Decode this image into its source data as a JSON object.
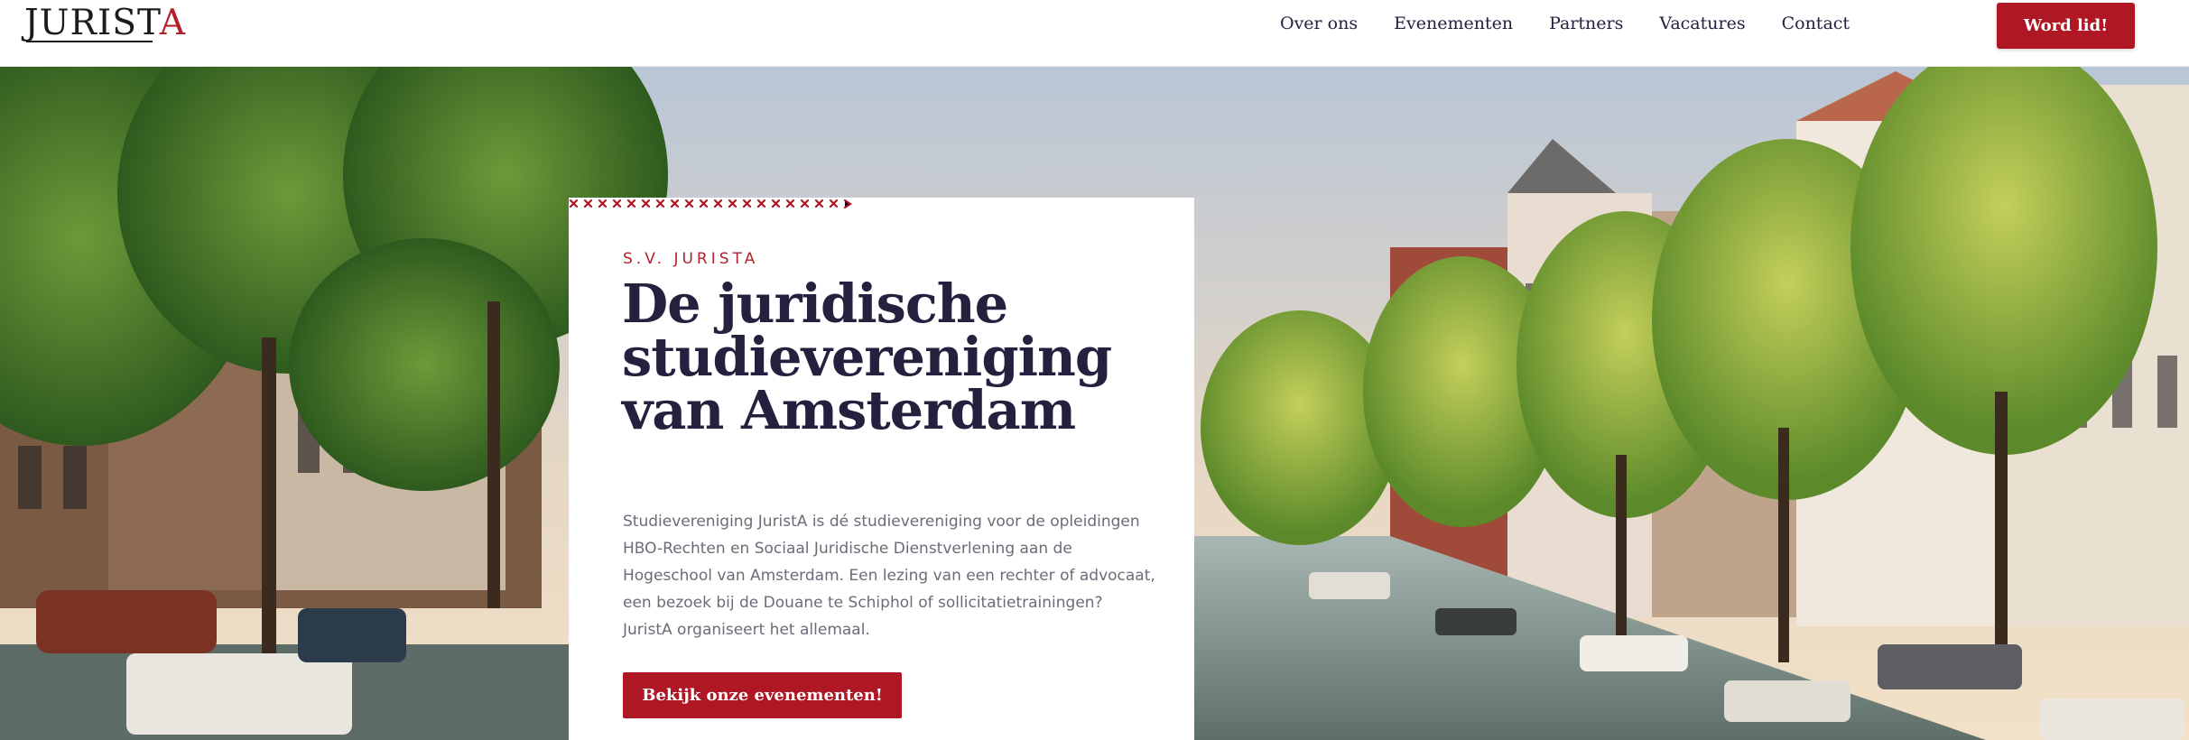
{
  "header": {
    "logo_text_main": "JURIST",
    "logo_text_accent": "A",
    "nav": [
      {
        "label": "Over ons"
      },
      {
        "label": "Evenementen"
      },
      {
        "label": "Partners"
      },
      {
        "label": "Vacatures"
      },
      {
        "label": "Contact"
      }
    ],
    "cta_label": "Word lid!"
  },
  "hero": {
    "image_icon": "amsterdam-canal-photo",
    "eyebrow": "S.V. JURISTA",
    "title_lines": [
      "De juridische",
      "studievereniging",
      "van Amsterdam"
    ],
    "divider_icon": "cross-pattern-divider",
    "body": "Studievereniging JuristA is dé studievereniging voor de opleidingen HBO-Rechten en Sociaal Juridische Dienstverlening aan de Hogeschool van Amsterdam. Een lezing van een rechter of advocaat, een bezoek bij de Douane te Schiphol of sollicitatietrainingen? JuristA organiseert het allemaal.",
    "cta_label": "Bekijk onze evenementen!"
  },
  "colors": {
    "brand_red": "#b01725",
    "heading_navy": "#24213f",
    "body_grey": "#6c6b78"
  }
}
